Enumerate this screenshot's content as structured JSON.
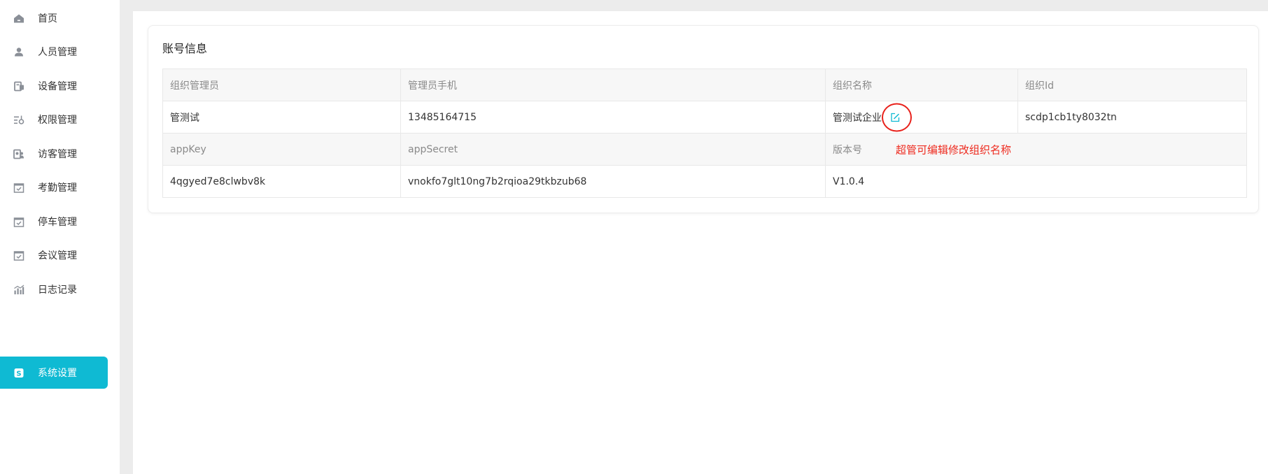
{
  "sidebar": {
    "items": [
      {
        "label": "首页",
        "icon": "home-icon",
        "active": false
      },
      {
        "label": "人员管理",
        "icon": "user-icon",
        "active": false
      },
      {
        "label": "设备管理",
        "icon": "device-icon",
        "active": false
      },
      {
        "label": "权限管理",
        "icon": "permission-icon",
        "active": false
      },
      {
        "label": "访客管理",
        "icon": "visitor-icon",
        "active": false
      },
      {
        "label": "考勤管理",
        "icon": "calendar-check-icon",
        "active": false
      },
      {
        "label": "停车管理",
        "icon": "calendar-check-icon",
        "active": false
      },
      {
        "label": "会议管理",
        "icon": "calendar-check-icon",
        "active": false
      },
      {
        "label": "日志记录",
        "icon": "chart-icon",
        "active": false
      },
      {
        "label": "系统设置",
        "icon": "settings-s-icon",
        "active": true
      }
    ]
  },
  "card": {
    "title": "账号信息",
    "row1_headers": [
      "组织管理员",
      "管理员手机",
      "组织名称",
      "组织Id"
    ],
    "row1_values": [
      "管测试",
      "13485164715",
      "管测试企业",
      "scdp1cb1ty8032tn"
    ],
    "row2_headers": [
      "appKey",
      "appSecret",
      "版本号"
    ],
    "row2_values": [
      "4qgyed7e8clwbv8k",
      "vnokfo7glt10ng7b2rqioa29tkbzub68",
      "V1.0.4"
    ],
    "edit_icon": "edit-icon",
    "annotation": "超管可编辑修改组织名称"
  },
  "colors": {
    "accent": "#0fbad3",
    "annotation_red": "#ee2a1e",
    "page_bg": "#ececec"
  }
}
